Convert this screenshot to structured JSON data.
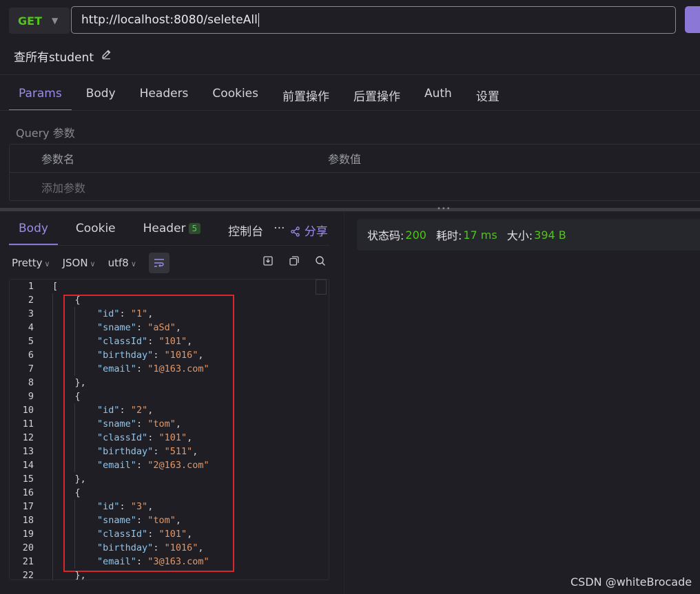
{
  "request": {
    "method": "GET",
    "url": "http://localhost:8080/seleteAll",
    "title": "查所有student"
  },
  "request_tabs": [
    "Params",
    "Body",
    "Headers",
    "Cookies",
    "前置操作",
    "后置操作",
    "Auth",
    "设置"
  ],
  "query": {
    "section_label": "Query 参数",
    "col_name": "参数名",
    "col_value": "参数值",
    "add_placeholder": "添加参数"
  },
  "response_tabs": {
    "body": "Body",
    "cookie": "Cookie",
    "header": "Header",
    "header_count": "5",
    "console": "控制台",
    "more": "···",
    "share": "分享"
  },
  "format_bar": {
    "pretty": "Pretty",
    "json": "JSON",
    "encoding": "utf8"
  },
  "status": {
    "code_label": "状态码:",
    "code_value": "200",
    "time_label": "耗时:",
    "time_value": "17 ms",
    "size_label": "大小:",
    "size_value": "394 B"
  },
  "code_lines": [
    {
      "n": "1",
      "t": "["
    },
    {
      "n": "2",
      "t": "    {"
    },
    {
      "n": "3",
      "k": "\"id\"",
      "v": "\"1\""
    },
    {
      "n": "4",
      "k": "\"sname\"",
      "v": "\"aSd\""
    },
    {
      "n": "5",
      "k": "\"classId\"",
      "v": "\"101\""
    },
    {
      "n": "6",
      "k": "\"birthday\"",
      "v": "\"1016\""
    },
    {
      "n": "7",
      "k": "\"email\"",
      "v": "\"1@163.com\"",
      "last": true
    },
    {
      "n": "8",
      "t": "    },"
    },
    {
      "n": "9",
      "t": "    {"
    },
    {
      "n": "10",
      "k": "\"id\"",
      "v": "\"2\""
    },
    {
      "n": "11",
      "k": "\"sname\"",
      "v": "\"tom\""
    },
    {
      "n": "12",
      "k": "\"classId\"",
      "v": "\"101\""
    },
    {
      "n": "13",
      "k": "\"birthday\"",
      "v": "\"511\""
    },
    {
      "n": "14",
      "k": "\"email\"",
      "v": "\"2@163.com\"",
      "last": true
    },
    {
      "n": "15",
      "t": "    },"
    },
    {
      "n": "16",
      "t": "    {"
    },
    {
      "n": "17",
      "k": "\"id\"",
      "v": "\"3\""
    },
    {
      "n": "18",
      "k": "\"sname\"",
      "v": "\"tom\""
    },
    {
      "n": "19",
      "k": "\"classId\"",
      "v": "\"101\""
    },
    {
      "n": "20",
      "k": "\"birthday\"",
      "v": "\"1016\""
    },
    {
      "n": "21",
      "k": "\"email\"",
      "v": "\"3@163.com\"",
      "last": true
    },
    {
      "n": "22",
      "t": "    },"
    }
  ],
  "watermark": "CSDN @whiteBrocade",
  "colors": {
    "accent": "#8b78d6",
    "method_get": "#52c41a",
    "highlight_box": "#d9262c"
  }
}
